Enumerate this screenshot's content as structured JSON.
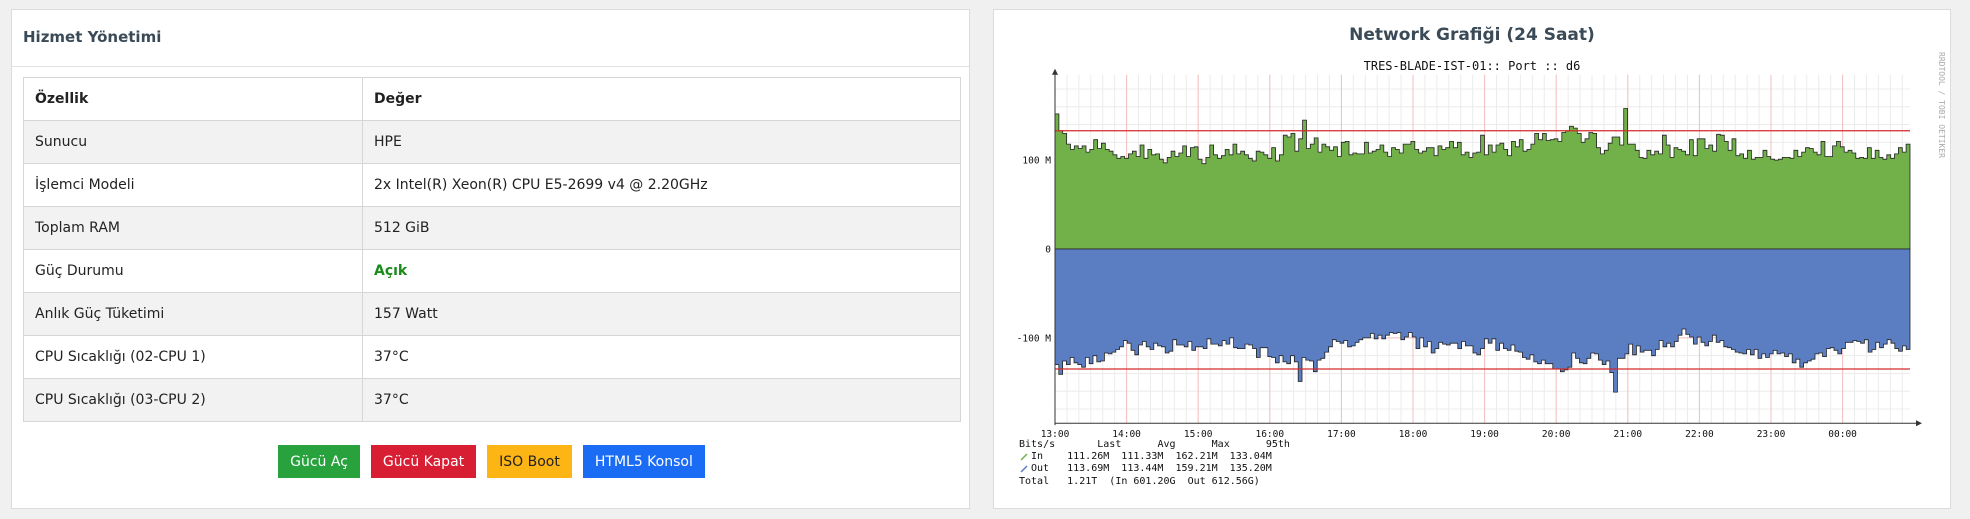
{
  "service_panel": {
    "title": "Hizmet Yönetimi",
    "headers": [
      "Özellik",
      "Değer"
    ],
    "rows": [
      {
        "k": "Sunucu",
        "v": "HPE"
      },
      {
        "k": "İşlemci Modeli",
        "v": "2x Intel(R) Xeon(R) CPU E5-2699 v4 @ 2.20GHz"
      },
      {
        "k": "Toplam RAM",
        "v": "512 GiB"
      },
      {
        "k": "Güç Durumu",
        "v": "Açık"
      },
      {
        "k": "Anlık Güç Tüketimi",
        "v": "157 Watt"
      },
      {
        "k": "CPU Sıcaklığı (02-CPU 1)",
        "v": "37°C"
      },
      {
        "k": "CPU Sıcaklığı (03-CPU 2)",
        "v": "37°C"
      }
    ],
    "buttons": {
      "power_on": "Gücü Aç",
      "power_off": "Gücü Kapat",
      "iso_boot": "ISO Boot",
      "console": "HTML5 Konsol"
    }
  },
  "network_panel": {
    "title": "Network Grafiği (24 Saat)",
    "graph_title": "TRES-BLADE-IST-01:: Port :: d6",
    "side_label": "RRDTOOL / TOBI OETIKER",
    "legend": {
      "header": "Bits/s       Last      Avg      Max      95th",
      "in": "In    111.26M  111.33M  162.21M  133.04M",
      "out": "Out   113.69M  113.44M  159.21M  135.20M",
      "total": "Total   1.21T  (In 601.20G  Out 612.56G)"
    }
  },
  "chart_data": {
    "type": "area",
    "title": "TRES-BLADE-IST-01:: Port :: d6",
    "x_ticks": [
      "13:00",
      "14:00",
      "15:00",
      "16:00",
      "17:00",
      "18:00",
      "19:00",
      "20:00",
      "21:00",
      "22:00",
      "23:00",
      "00:00"
    ],
    "y_ticks": [
      {
        "label": "100 M",
        "value": 100
      },
      {
        "label": "0",
        "value": 0
      },
      {
        "label": "-100 M",
        "value": -100
      }
    ],
    "ylim": [
      -196,
      196
    ],
    "hrule_in": 133,
    "hrule_out": -135,
    "colors": {
      "in": "#72b04a",
      "out": "#5b7ec2",
      "rule": "#d42a2a",
      "grid": "#f2c0c0"
    },
    "series": [
      {
        "name": "In",
        "values": [
          152,
          133,
          130,
          118,
          112,
          116,
          113,
          116,
          109,
          112,
          123,
          113,
          119,
          112,
          110,
          106,
          102,
          104,
          102,
          107,
          110,
          104,
          117,
          102,
          112,
          106,
          107,
          101,
          97,
          103,
          110,
          104,
          108,
          116,
          104,
          114,
          115,
          101,
          96,
          103,
          117,
          106,
          102,
          105,
          112,
          106,
          118,
          107,
          110,
          106,
          102,
          99,
          110,
          109,
          106,
          102,
          114,
          99,
          106,
          128,
          126,
          130,
          110,
          124,
          145,
          113,
          118,
          125,
          109,
          118,
          115,
          111,
          115,
          104,
          120,
          121,
          106,
          108,
          107,
          107,
          120,
          108,
          110,
          112,
          117,
          109,
          104,
          114,
          112,
          108,
          118,
          118,
          121,
          112,
          108,
          110,
          114,
          114,
          105,
          116,
          112,
          114,
          121,
          114,
          120,
          106,
          109,
          103,
          108,
          109,
          128,
          106,
          117,
          109,
          117,
          119,
          112,
          105,
          121,
          115,
          123,
          110,
          112,
          118,
          130,
          123,
          130,
          122,
          123,
          124,
          121,
          131,
          133,
          138,
          136,
          130,
          120,
          124,
          131,
          130,
          114,
          107,
          111,
          119,
          126,
          126,
          117,
          158,
          118,
          118,
          111,
          103,
          102,
          111,
          106,
          110,
          107,
          128,
          117,
          103,
          114,
          112,
          110,
          106,
          123,
          105,
          124,
          124,
          113,
          117,
          110,
          129,
          128,
          121,
          111,
          124,
          105,
          107,
          102,
          111,
          101,
          103,
          103,
          111,
          104,
          101,
          100,
          101,
          103,
          103,
          102,
          111,
          104,
          109,
          114,
          113,
          109,
          106,
          121,
          104,
          104,
          116,
          121,
          115,
          109,
          111,
          108,
          102,
          103,
          102,
          114,
          102,
          111,
          103,
          101,
          106,
          102,
          107,
          114,
          109,
          118
        ]
      },
      {
        "name": "Out",
        "values": [
          -130,
          -141,
          -126,
          -130,
          -122,
          -128,
          -130,
          -133,
          -122,
          -129,
          -120,
          -127,
          -126,
          -117,
          -118,
          -116,
          -113,
          -110,
          -103,
          -106,
          -114,
          -119,
          -108,
          -104,
          -110,
          -113,
          -106,
          -109,
          -110,
          -117,
          -115,
          -102,
          -108,
          -108,
          -110,
          -104,
          -114,
          -110,
          -110,
          -112,
          -101,
          -107,
          -107,
          -109,
          -103,
          -107,
          -100,
          -111,
          -112,
          -112,
          -107,
          -108,
          -112,
          -122,
          -111,
          -111,
          -121,
          -122,
          -128,
          -120,
          -127,
          -129,
          -120,
          -127,
          -149,
          -122,
          -125,
          -126,
          -138,
          -125,
          -123,
          -116,
          -110,
          -102,
          -104,
          -106,
          -103,
          -110,
          -109,
          -105,
          -102,
          -100,
          -100,
          -95,
          -101,
          -97,
          -101,
          -97,
          -94,
          -95,
          -94,
          -102,
          -99,
          -94,
          -99,
          -112,
          -100,
          -110,
          -104,
          -117,
          -112,
          -105,
          -107,
          -108,
          -106,
          -106,
          -112,
          -104,
          -109,
          -109,
          -117,
          -119,
          -112,
          -101,
          -106,
          -101,
          -114,
          -106,
          -112,
          -114,
          -108,
          -115,
          -116,
          -122,
          -124,
          -119,
          -127,
          -129,
          -125,
          -129,
          -129,
          -135,
          -135,
          -138,
          -136,
          -133,
          -117,
          -123,
          -128,
          -129,
          -123,
          -117,
          -118,
          -125,
          -130,
          -126,
          -139,
          -161,
          -123,
          -123,
          -118,
          -107,
          -119,
          -109,
          -116,
          -114,
          -114,
          -120,
          -113,
          -103,
          -110,
          -106,
          -110,
          -104,
          -97,
          -90,
          -96,
          -99,
          -107,
          -99,
          -105,
          -109,
          -104,
          -97,
          -105,
          -103,
          -110,
          -111,
          -113,
          -116,
          -117,
          -118,
          -113,
          -119,
          -113,
          -123,
          -118,
          -122,
          -118,
          -114,
          -118,
          -117,
          -121,
          -118,
          -128,
          -124,
          -133,
          -128,
          -126,
          -124,
          -118,
          -117,
          -121,
          -112,
          -111,
          -114,
          -118,
          -112,
          -105,
          -105,
          -103,
          -104,
          -106,
          -102,
          -116,
          -113,
          -105,
          -111,
          -107,
          -102,
          -106,
          -112,
          -115,
          -109,
          -113
        ]
      }
    ]
  }
}
